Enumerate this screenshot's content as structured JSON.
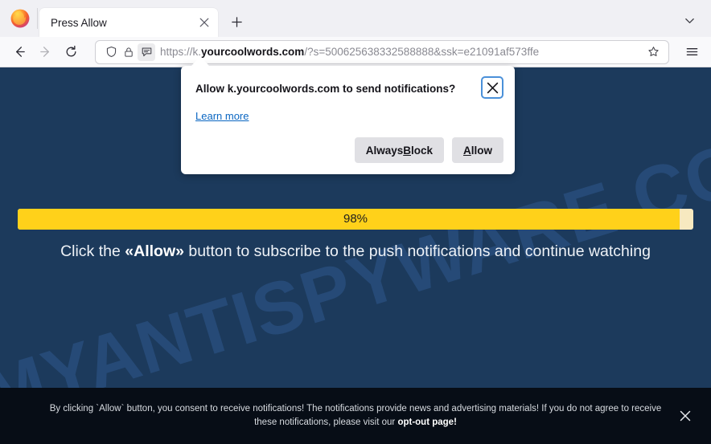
{
  "browser": {
    "app_icon": "firefox-logo",
    "tab": {
      "title": "Press Allow",
      "close_icon": "close-icon"
    },
    "new_tab_icon": "plus-icon",
    "tab_list_icon": "chevron-down-icon",
    "nav": {
      "back_icon": "back-arrow-icon",
      "forward_icon": "forward-arrow-icon",
      "reload_icon": "reload-icon",
      "menu_icon": "hamburger-menu-icon"
    },
    "urlbar": {
      "shield_icon": "shield-icon",
      "lock_icon": "padlock-icon",
      "permission_icon": "notification-bubble-icon",
      "bookmark_icon": "star-icon",
      "url_scheme": "https://k.",
      "url_host": "yourcoolwords.com",
      "url_rest": "/?s=500625638332588888&ssk=e21091af573ffe",
      "url_full": "https://k.yourcoolwords.com/?s=500625638332588888&ssk=e21091af573ffe"
    }
  },
  "doorhanger": {
    "title": "Allow k.yourcoolwords.com to send notifications?",
    "close_icon": "close-icon",
    "learn_more": "Learn more",
    "block_label_pre": "Always ",
    "block_label_key": "B",
    "block_label_post": "lock",
    "allow_label_key": "A",
    "allow_label_post": "llow"
  },
  "page": {
    "watermark": "MYANTISPYWARE.COM",
    "progress": {
      "percent_label": "98%",
      "percent_value": 98
    },
    "cta_pre": "Click the ",
    "cta_bold": "«Allow»",
    "cta_post": " button to subscribe to the push notifications and continue watching",
    "consent": {
      "text_pre": "By clicking `Allow` button, you consent to receive notifications! The notifications provide news and advertising materials! If you do not agree to receive these notifications, please visit our ",
      "text_link": "opt-out page!",
      "close_icon": "close-icon"
    }
  },
  "colors": {
    "page_bg": "#1c3a5c",
    "progress_fill": "#ffd11a",
    "progress_track": "#f7e9c0",
    "consent_bg": "#070d16",
    "watermark": "#2a5080",
    "link": "#0a66c2"
  }
}
